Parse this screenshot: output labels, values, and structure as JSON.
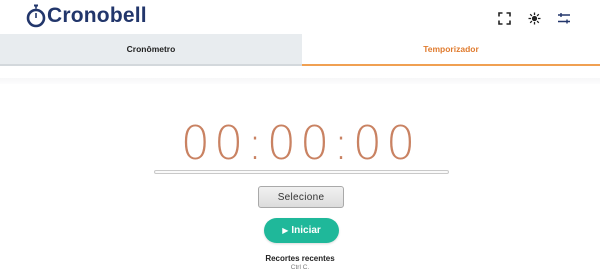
{
  "app": {
    "name": "Cronobell"
  },
  "header": {
    "icons": [
      "fullscreen-icon",
      "theme-sun-icon",
      "settings-sliders-icon"
    ]
  },
  "tabs": [
    {
      "label": "Cronômetro",
      "active": false
    },
    {
      "label": "Temporizador",
      "active": true
    }
  ],
  "timer": {
    "display": "00:00:00",
    "progress": 0
  },
  "buttons": {
    "select_label": "Selecione",
    "start_label": "Iniciar"
  },
  "recent": {
    "title": "Recortes recentes",
    "hint": "Ctrl C."
  },
  "colors": {
    "brand": "#22366b",
    "accent": "#e07b2e",
    "digits": "#c98262",
    "start": "#1fb89a"
  }
}
